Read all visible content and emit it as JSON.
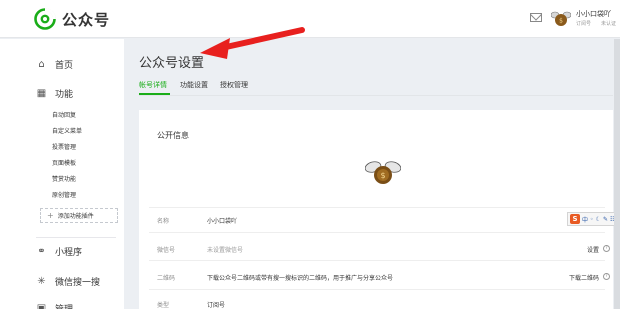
{
  "header": {
    "app_name": "公众号",
    "account_name": "小小口袋吖",
    "account_type": "订阅号",
    "verify_status": "未认证"
  },
  "sidebar": {
    "home": "首页",
    "features": "功能",
    "sub_items": [
      "自动回复",
      "自定义菜单",
      "投票管理",
      "页面模板",
      "赞赏功能",
      "原创管理"
    ],
    "add_plugin": "添加功能插件",
    "mini_program": "小程序",
    "wechat_search": "微信搜一搜",
    "manage": "管理"
  },
  "main": {
    "title": "公众号设置",
    "tabs": [
      {
        "label": "帐号详情",
        "active": true
      },
      {
        "label": "功能设置",
        "active": false
      },
      {
        "label": "授权管理",
        "active": false
      }
    ]
  },
  "card": {
    "section_title": "公开信息",
    "rows": [
      {
        "label": "名称",
        "value": "小小口袋吖",
        "action": ""
      },
      {
        "label": "微信号",
        "value": "未设置微信号",
        "action": "设置"
      },
      {
        "label": "二维码",
        "value": "下载公众号二维码或带有搜一搜标识的二维码，用于推广与分享公众号",
        "action": "下载二维码"
      },
      {
        "label": "类型",
        "value": "订阅号",
        "action": ""
      }
    ]
  },
  "ime": {
    "logo": "S",
    "mode": "中"
  },
  "colors": {
    "accent": "#1aad19",
    "arrow": "#e8201e",
    "topbar_bg": "#ffffff",
    "page_bg": "#eceff3"
  },
  "icons": [
    "wechat-official-logo",
    "mail-icon",
    "avatar",
    "home-icon",
    "grid-icon",
    "plus-icon",
    "link-icon",
    "sparkle-icon",
    "manage-icon",
    "help-icon",
    "sogou-ime-icon"
  ]
}
